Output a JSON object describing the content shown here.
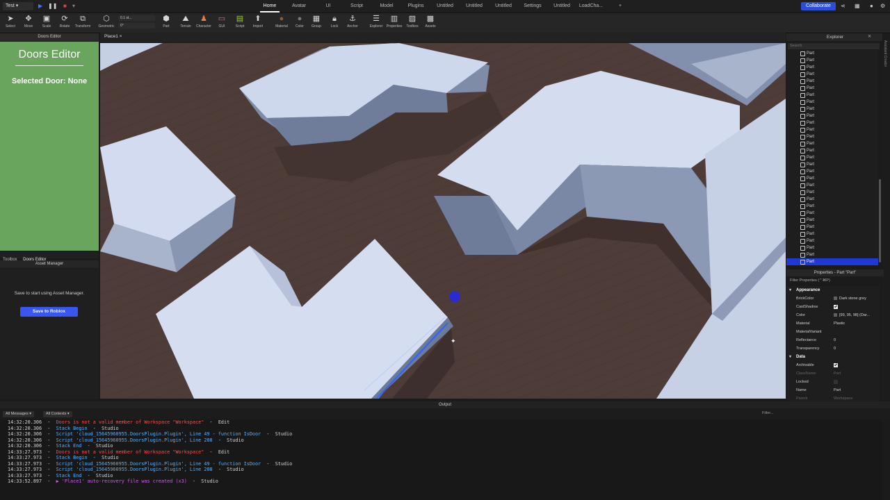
{
  "topbar": {
    "mode": "Test",
    "tabs": [
      "Home",
      "Avatar",
      "UI",
      "Script",
      "Model",
      "Plugins",
      "Untitled",
      "Untitled",
      "Untitled",
      "Settings",
      "Untitled",
      "LoadCha..."
    ],
    "add_tab": "+",
    "collaborate": "Collaborate"
  },
  "toolbar": {
    "tools": [
      "Select",
      "Move",
      "Scale",
      "Rotate",
      "Transform",
      "Geometric",
      "Part",
      "Terrain",
      "Character",
      "GUI",
      "Script",
      "Import",
      "Material",
      "Color",
      "Group",
      "Lock",
      "Anchor",
      "Explorer",
      "Properties",
      "Toolbox",
      "Assets"
    ],
    "snap1": "0.1 st...",
    "snap2": "0°"
  },
  "doors": {
    "header": "Doors Editor",
    "title": "Doors Editor",
    "selected": "Selected Door: None"
  },
  "left_tabs": [
    "Toolbox",
    "Doors Editor"
  ],
  "asset": {
    "header": "Asset Manager",
    "message": "Save to start using Asset Manager.",
    "button": "Save to Roblox"
  },
  "viewport": {
    "tab": "Place1"
  },
  "explorer": {
    "header": "Explorer",
    "search_placeholder": "Search",
    "items": [
      "Part",
      "Part",
      "Part",
      "Part",
      "Part",
      "Part",
      "Part",
      "Part",
      "Part",
      "Part",
      "Part",
      "Part",
      "Part",
      "Part",
      "Part",
      "Part",
      "Part",
      "Part",
      "Part",
      "Part",
      "Part",
      "Part",
      "Part",
      "Part",
      "Part",
      "Part",
      "Part",
      "Part",
      "Part",
      "Part",
      "Part"
    ],
    "selected_index": 30
  },
  "side_strip_label": "Assistant Creator",
  "properties": {
    "header": "Properties - Part \"Part\"",
    "filter": "Filter Properties (⌃⌘P)",
    "sections": [
      {
        "name": "Appearance",
        "rows": [
          {
            "k": "BrickColor",
            "v": "Dark stone grey",
            "type": "swatch"
          },
          {
            "k": "CastShadow",
            "v": "",
            "type": "check"
          },
          {
            "k": "Color",
            "v": "[99, 95, 98] (Dar...",
            "type": "swatch"
          },
          {
            "k": "Material",
            "v": "Plastic",
            "type": "text"
          },
          {
            "k": "MaterialVariant",
            "v": "",
            "type": "text"
          },
          {
            "k": "Reflectance",
            "v": "0",
            "type": "text"
          },
          {
            "k": "Transparency",
            "v": "0",
            "type": "text"
          }
        ]
      },
      {
        "name": "Data",
        "rows": [
          {
            "k": "Archivable",
            "v": "",
            "type": "check"
          },
          {
            "k": "ClassName",
            "v": "Part",
            "type": "dim"
          },
          {
            "k": "Locked",
            "v": "",
            "type": "uncheck"
          },
          {
            "k": "Name",
            "v": "Part",
            "type": "text"
          },
          {
            "k": "Parent",
            "v": "Workspace",
            "type": "dim"
          }
        ]
      }
    ]
  },
  "output": {
    "header": "Output",
    "filter_messages": "All Messages",
    "filter_contexts": "All Contexts",
    "filter_placeholder": "Filter...",
    "lines": [
      {
        "ts": "14:32:20.306",
        "cls": "err",
        "msg": "Doors is not a valid member of Workspace \"Workspace\"",
        "src": "Edit"
      },
      {
        "ts": "14:32:20.306",
        "cls": "inf",
        "msg": "Stack Begin",
        "src": "Studio"
      },
      {
        "ts": "14:32:20.306",
        "cls": "inf",
        "msg": "Script 'cloud_15645960955.DoorsPlugin.Plugin', Line 49 - function IsDoor",
        "src": "Studio"
      },
      {
        "ts": "14:32:20.306",
        "cls": "inf",
        "msg": "Script 'cloud_15645960955.DoorsPlugin.Plugin', Line 208",
        "src": "Studio"
      },
      {
        "ts": "14:32:20.306",
        "cls": "inf",
        "msg": "Stack End",
        "src": "Studio"
      },
      {
        "ts": "14:33:27.973",
        "cls": "err",
        "msg": "Doors is not a valid member of Workspace \"Workspace\"",
        "src": "Edit"
      },
      {
        "ts": "14:33:27.973",
        "cls": "inf",
        "msg": "Stack Begin",
        "src": "Studio"
      },
      {
        "ts": "14:33:27.973",
        "cls": "inf",
        "msg": "Script 'cloud_15645960955.DoorsPlugin.Plugin', Line 49 - function IsDoor",
        "src": "Studio"
      },
      {
        "ts": "14:33:27.973",
        "cls": "inf",
        "msg": "Script 'cloud_15645960955.DoorsPlugin.Plugin', Line 208",
        "src": "Studio"
      },
      {
        "ts": "14:33:27.973",
        "cls": "inf",
        "msg": "Stack End",
        "src": "Studio"
      },
      {
        "ts": "14:33:52.897",
        "cls": "pur",
        "msg": "▶ 'Place1' auto-recovery file was created (x3)",
        "src": "Studio"
      }
    ]
  },
  "colors": {
    "accent": "#3857f2",
    "panel_green": "#69a55c",
    "selection": "#1f38d6",
    "error": "#ff4b4b",
    "info": "#5ab0ff"
  }
}
